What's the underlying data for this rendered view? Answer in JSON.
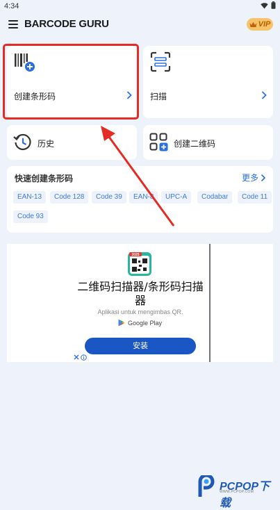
{
  "status_bar": {
    "time": "4:34"
  },
  "app_bar": {
    "title": "BARCODE GURU",
    "vip_label": "VIP"
  },
  "actions": {
    "create_barcode": "创建条形码",
    "scan": "扫描",
    "history": "历史",
    "create_qr": "创建二维码"
  },
  "quick_create": {
    "title": "快速创建条形码",
    "more_label": "更多",
    "chips": [
      "EAN-13",
      "Code 128",
      "Code 39",
      "EAN-8",
      "UPC-A",
      "Codabar",
      "Code 11",
      "Code 93"
    ]
  },
  "ad": {
    "icon_badge": "2025",
    "title_line1": "二维码扫描器/条形码扫描",
    "title_line2": "器",
    "subtitle": "Aplikasi untuk mengimbas QR.",
    "store_label": "Google Play",
    "install_label": "安装"
  },
  "watermark": {
    "brand": "PCPOP下载",
    "sub": "WWW.PCPOP.COM"
  },
  "colors": {
    "accent": "#2a6fe0",
    "highlight": "#e42b24",
    "vip": "#f5c46a",
    "install": "#1a56c4"
  }
}
